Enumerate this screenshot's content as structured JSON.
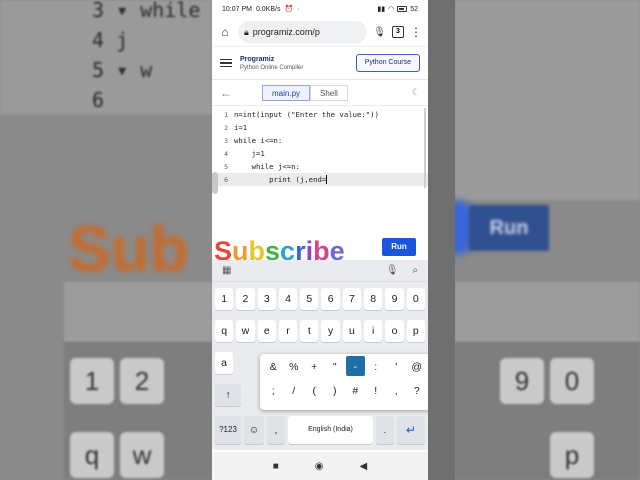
{
  "status": {
    "time": "10:07 PM",
    "speed": "0.0KB/s",
    "battery": "52"
  },
  "browser": {
    "url": "programiz.com/p",
    "tab_count": "3"
  },
  "site": {
    "logo": "Programiz",
    "subtitle": "Python Online Compiler",
    "course_button": "Python Course"
  },
  "editor": {
    "tabs": [
      "main.py",
      "Shell"
    ],
    "lines": [
      {
        "num": "1",
        "code": "n=int(input (\"Enter the value:\"))"
      },
      {
        "num": "2",
        "code": "i=1"
      },
      {
        "num": "3",
        "code": "while i<=n:"
      },
      {
        "num": "4",
        "code": "    j=1"
      },
      {
        "num": "5",
        "code": "    while j<=n:"
      },
      {
        "num": "6",
        "code": "        print (j,end="
      }
    ]
  },
  "overlay": {
    "subscribe": "Subscribe",
    "run": "Run"
  },
  "keyboard": {
    "numbers": [
      "1",
      "2",
      "3",
      "4",
      "5",
      "6",
      "7",
      "8",
      "9",
      "0"
    ],
    "row_q": [
      "q",
      "w",
      "e",
      "r",
      "t",
      "y",
      "u",
      "i",
      "o",
      "p"
    ],
    "row_a_first": "a",
    "popup_row1": [
      "&",
      "%",
      "+",
      "\"",
      "-",
      ":",
      "'",
      "@"
    ],
    "popup_row2": [
      ";",
      "/",
      "(",
      ")",
      "#",
      "!",
      ",",
      "?"
    ],
    "bottom": {
      "sym": "?123",
      "emoji": "☺",
      "comma": ",",
      "space": "English (India)",
      "period": ".",
      "enter": "↵"
    },
    "shift": "↑"
  },
  "background": {
    "left_lines": [
      "3 ▾  while",
      "4       j",
      "5 ▾     w",
      "6"
    ],
    "left_subscribe": "Sub",
    "right_run": "Run",
    "right_digits": [
      "9",
      "0"
    ],
    "right_letters": [
      "p"
    ],
    "left_keys": [
      "1",
      "2",
      "q",
      "w"
    ]
  }
}
